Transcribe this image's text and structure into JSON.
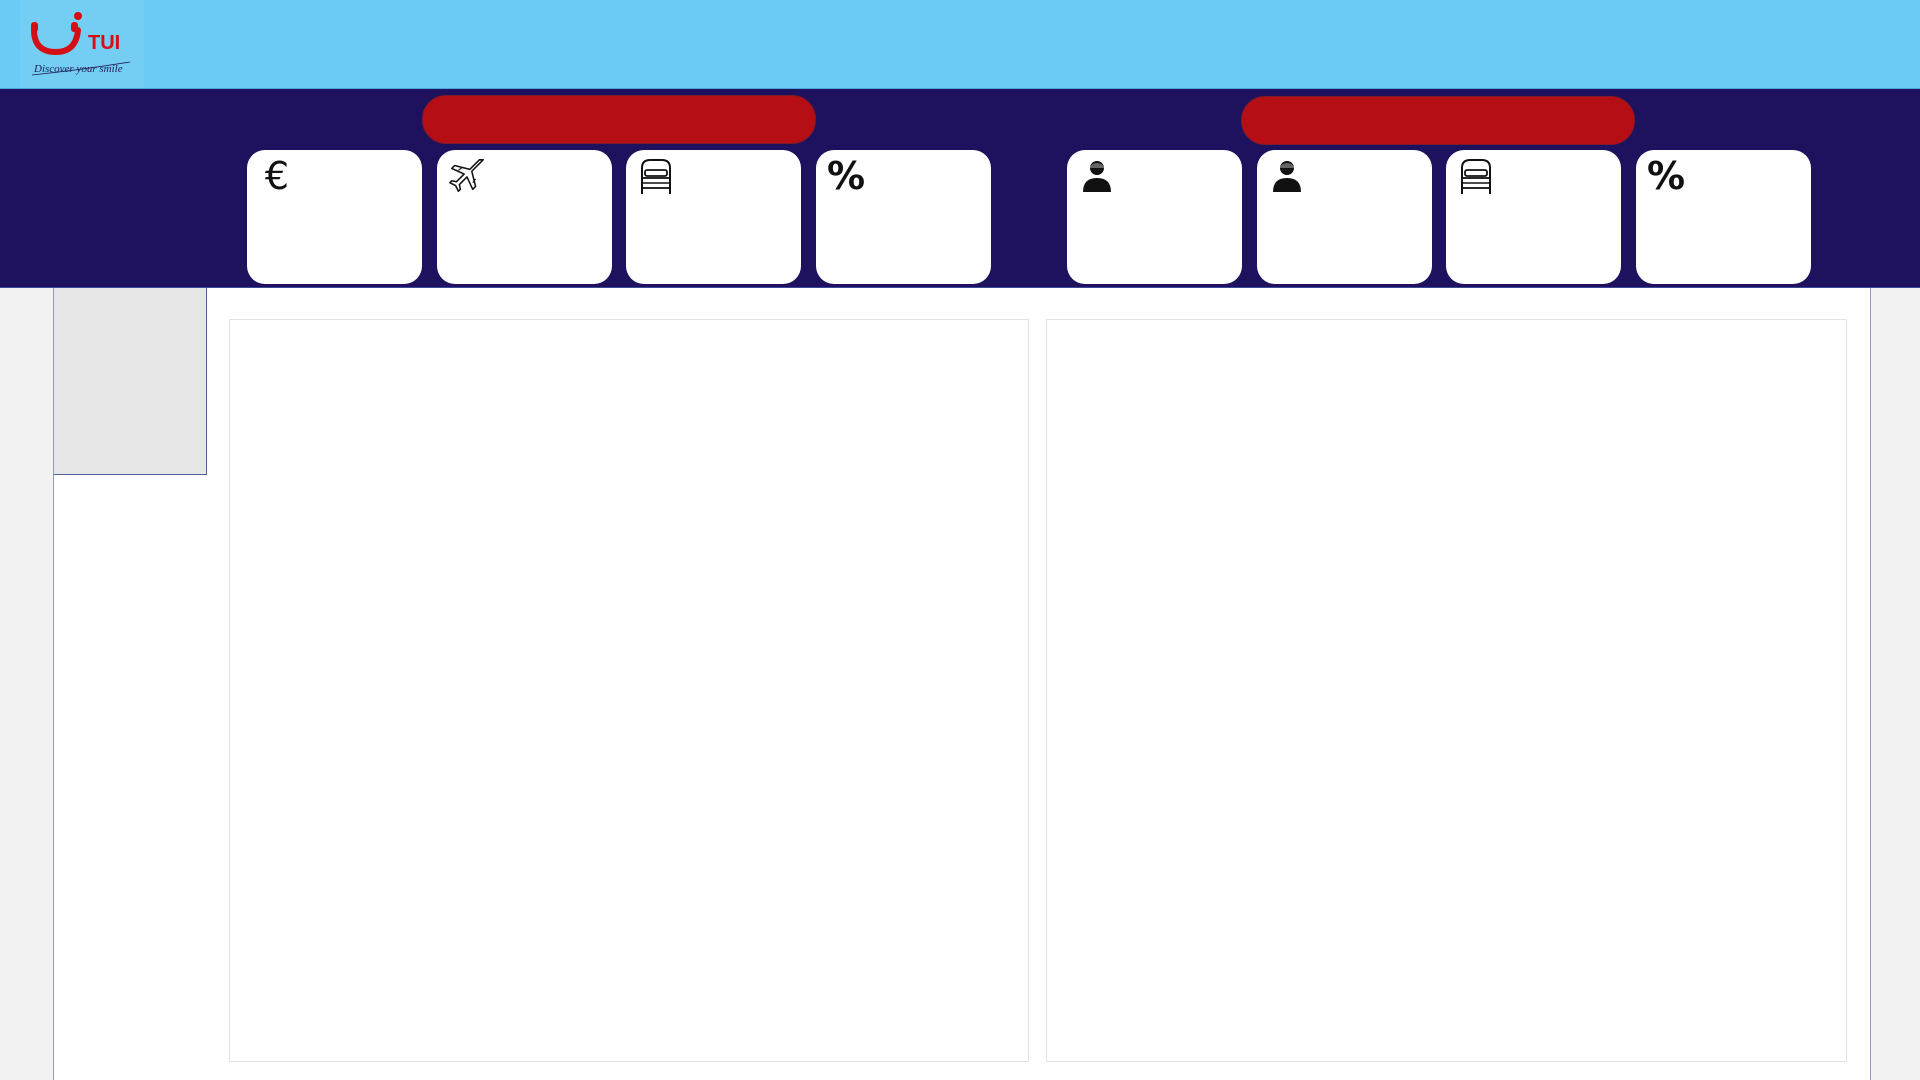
{
  "brand": {
    "name": "TUI",
    "tagline": "Discover your smile",
    "logo_red": "#d40e14"
  },
  "colors": {
    "topbar": "#6ccbf4",
    "navband": "#1e115d",
    "pill": "#b50e14",
    "card": "#ffffff"
  },
  "groups": [
    {
      "pill_label": "",
      "cards": [
        {
          "icon": "euro-icon",
          "glyph": "€",
          "label": "",
          "value": ""
        },
        {
          "icon": "airplane-icon",
          "glyph": "",
          "label": "",
          "value": ""
        },
        {
          "icon": "bed-icon",
          "glyph": "",
          "label": "",
          "value": ""
        },
        {
          "icon": "percent-icon",
          "glyph": "%",
          "label": "",
          "value": ""
        }
      ]
    },
    {
      "pill_label": "",
      "cards": [
        {
          "icon": "user-icon",
          "glyph": "",
          "label": "",
          "value": ""
        },
        {
          "icon": "user-icon",
          "glyph": "",
          "label": "",
          "value": ""
        },
        {
          "icon": "bed-icon",
          "glyph": "",
          "label": "",
          "value": ""
        },
        {
          "icon": "percent-icon",
          "glyph": "%",
          "label": "",
          "value": ""
        }
      ]
    }
  ]
}
